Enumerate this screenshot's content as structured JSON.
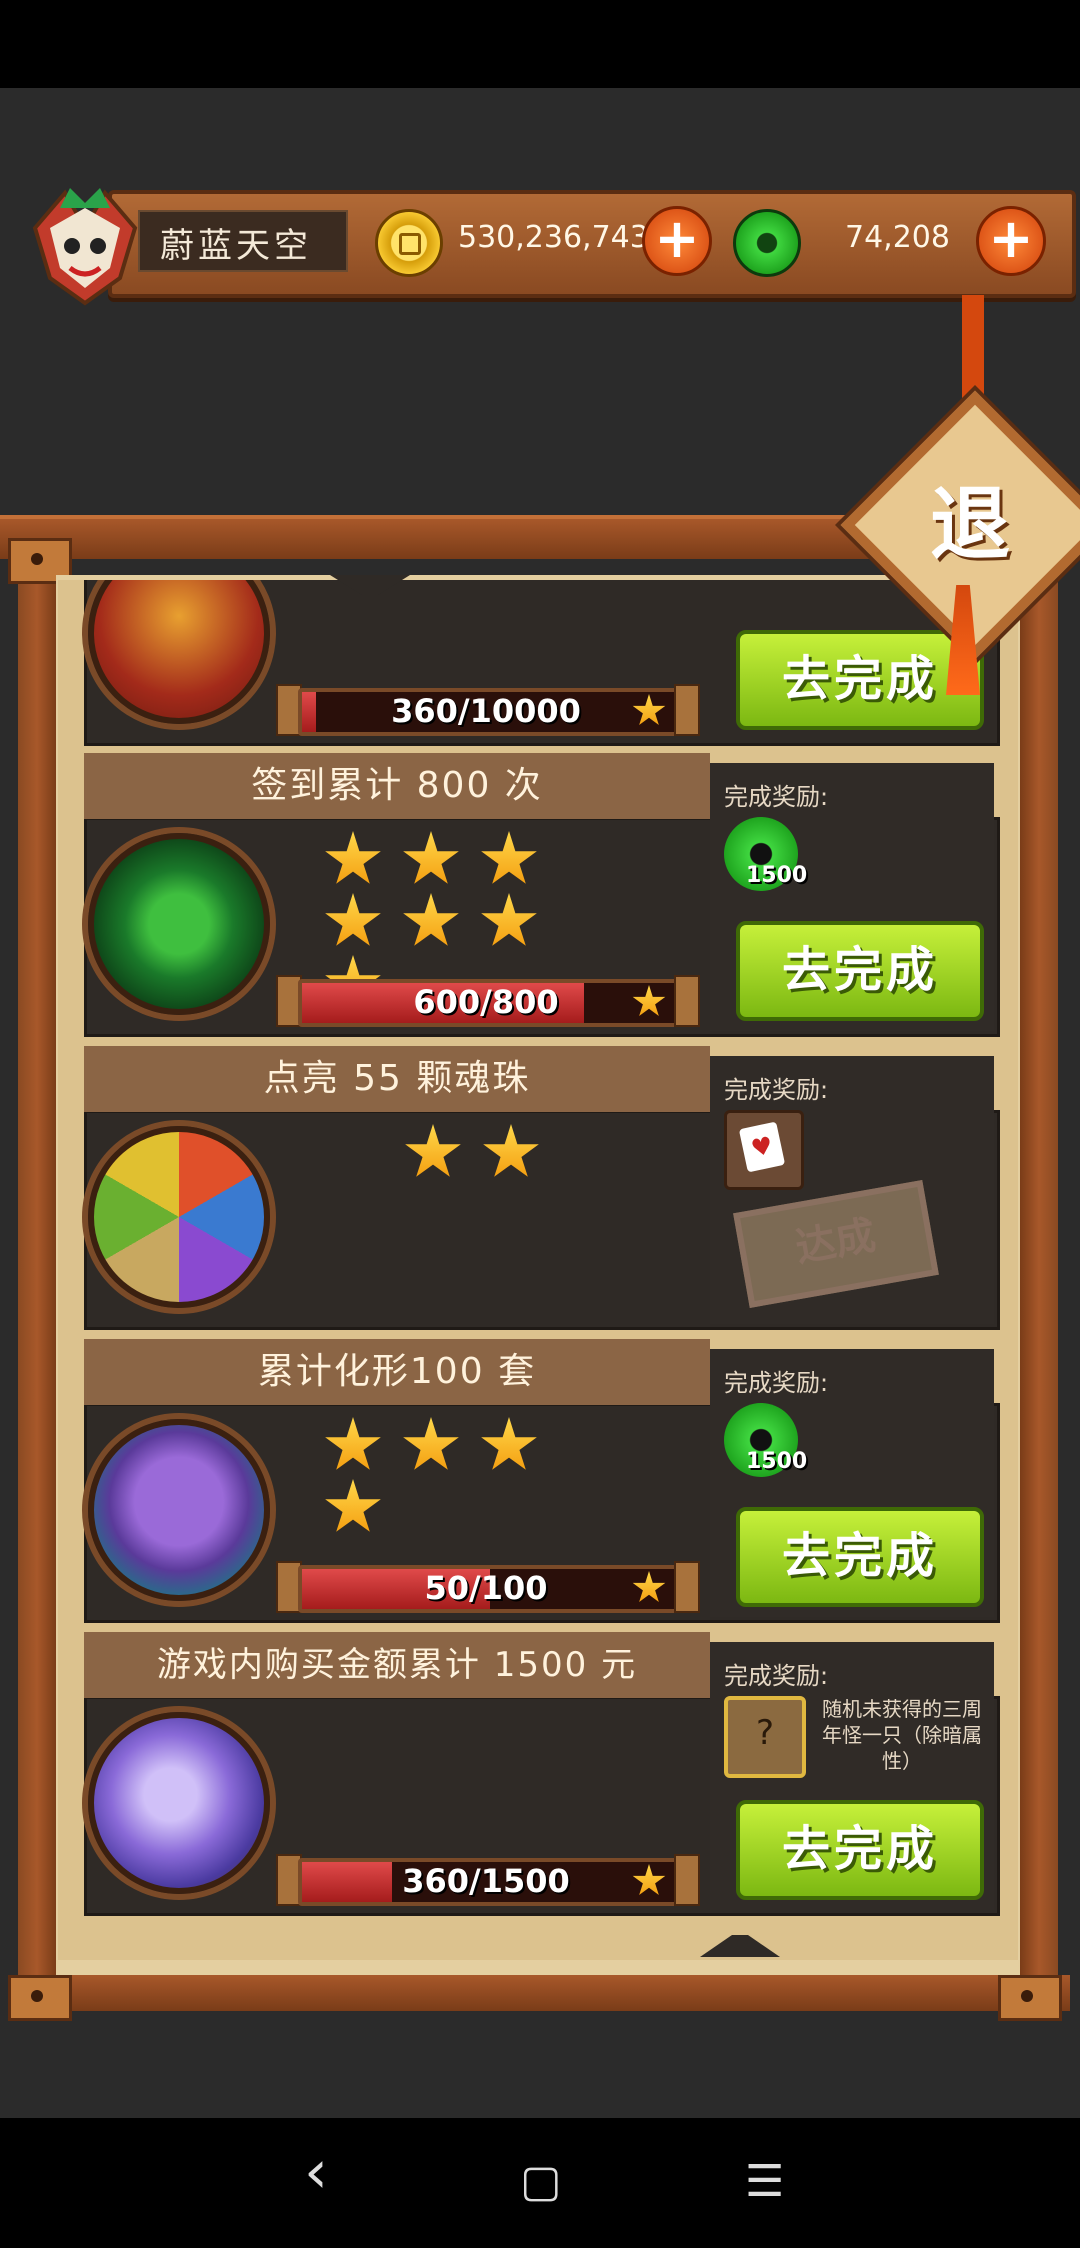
{
  "player": {
    "name": "蔚蓝天空"
  },
  "currency": {
    "gold": "530,236,743",
    "jade": "74,208",
    "plus_label": "+"
  },
  "exit_label": "退",
  "tasks": [
    {
      "title": "",
      "icon": "gold-pouch-icon",
      "progress_text": "360/10000",
      "progress": 0.036,
      "button": "去完成"
    },
    {
      "title": "签到累计 800 次",
      "icon": "green-shrine-icon",
      "stars": 7,
      "progress_text": "600/800",
      "progress": 0.75,
      "reward_label": "完成奖励:",
      "reward_icon": "jade-coin-icon",
      "reward_count": "1500",
      "button": "去完成"
    },
    {
      "title": "点亮 55 颗魂珠",
      "icon": "soul-orbs-icon",
      "stars": 2,
      "reward_label": "完成奖励:",
      "reward_icon": "card-icon",
      "stamp": "达成"
    },
    {
      "title": "累计化形100 套",
      "icon": "wizard-hat-icon",
      "stars": 4,
      "progress_text": "50/100",
      "progress": 0.5,
      "reward_label": "完成奖励:",
      "reward_icon": "jade-coin-icon",
      "reward_count": "1500",
      "button": "去完成"
    },
    {
      "title": "游戏内购买金额累计 1500 元",
      "icon": "crystal-shell-icon",
      "progress_text": "360/1500",
      "progress": 0.24,
      "reward_label": "完成奖励:",
      "reward_icon": "mystery-monster-icon",
      "reward_mystery_glyph": "?",
      "reward_desc": "随机未获得的三周年怪一只（除暗属性）",
      "button": "去完成"
    }
  ],
  "nav": {
    "back": "‹",
    "home": "▢",
    "menu": "☰"
  },
  "colors": {
    "button_green": "#9ad21f",
    "title_brown": "#8b6545",
    "frame": "#a8582a",
    "paper": "#dcc28e"
  }
}
